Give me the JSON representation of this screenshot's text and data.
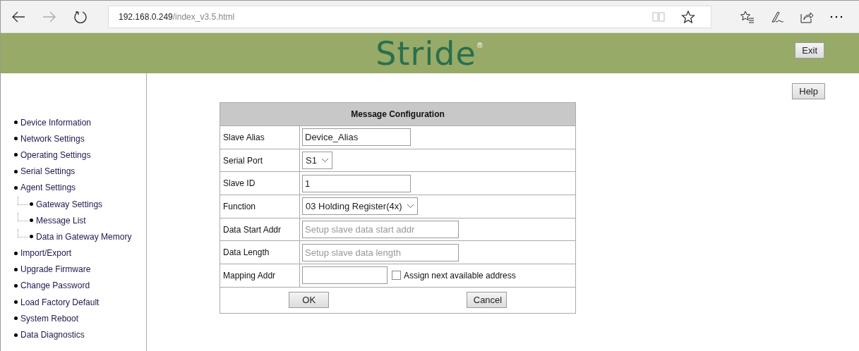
{
  "browser": {
    "url_host": "192.168.0.249",
    "url_path": "/index_v3.5.html"
  },
  "header": {
    "logo": "Stride",
    "logo_mark": "®",
    "exit_button": "Exit"
  },
  "help_button": "Help",
  "sidebar": {
    "items": [
      {
        "label": "Device Information"
      },
      {
        "label": "Network Settings"
      },
      {
        "label": "Operating Settings"
      },
      {
        "label": "Serial Settings"
      },
      {
        "label": "Agent Settings",
        "children": [
          {
            "label": "Gateway Settings"
          },
          {
            "label": "Message List"
          },
          {
            "label": "Data in Gateway Memory"
          }
        ]
      },
      {
        "label": "Import/Export"
      },
      {
        "label": "Upgrade Firmware"
      },
      {
        "label": "Change Password"
      },
      {
        "label": "Load Factory Default"
      },
      {
        "label": "System Reboot"
      },
      {
        "label": "Data Diagnostics"
      }
    ]
  },
  "form": {
    "title": "Message Configuration",
    "rows": [
      {
        "label": "Slave Alias",
        "kind": "text",
        "value": "Device_Alias"
      },
      {
        "label": "Serial Port",
        "kind": "select",
        "value": "S1"
      },
      {
        "label": "Slave ID",
        "kind": "text",
        "value": "1"
      },
      {
        "label": "Function",
        "kind": "select",
        "value": "03 Holding Register(4x)"
      },
      {
        "label": "Data Start Addr",
        "kind": "wide",
        "placeholder": "Setup slave data start addr"
      },
      {
        "label": "Data Length",
        "kind": "wide",
        "placeholder": "Setup slave data length"
      },
      {
        "label": "Mapping Addr",
        "kind": "mapping",
        "checkbox": {
          "label": "Assign next available address",
          "checked": false
        }
      }
    ],
    "buttons": [
      "OK",
      "Cancel"
    ]
  }
}
